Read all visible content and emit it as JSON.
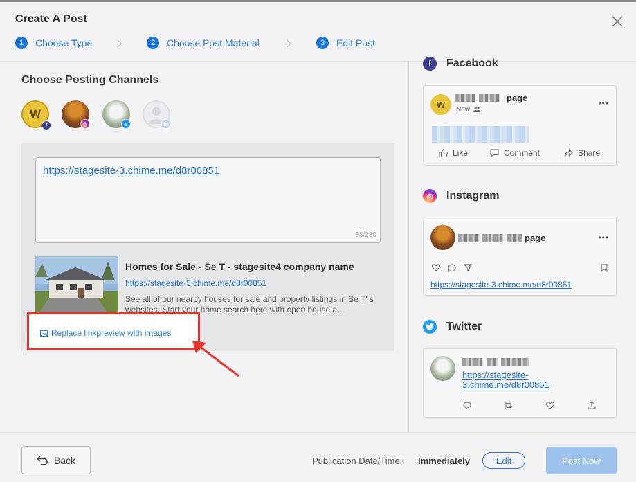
{
  "modal": {
    "title": "Create A Post"
  },
  "steps": [
    {
      "number": "1",
      "label": "Choose Type"
    },
    {
      "number": "2",
      "label": "Choose Post Material"
    },
    {
      "number": "3",
      "label": "Edit Post"
    }
  ],
  "channels": {
    "title": "Choose Posting Channels",
    "accounts": [
      {
        "initial": "W",
        "network": "facebook",
        "selected": true
      },
      {
        "network": "instagram",
        "selected": true
      },
      {
        "network": "twitter",
        "selected": true
      },
      {
        "network": "linkedin",
        "selected": false
      }
    ]
  },
  "editor": {
    "text": "https://stagesite-3.chime.me/d8r00851",
    "counter": "38/280"
  },
  "link_preview": {
    "title": "Homes for Sale - Se T - stagesite4 company name",
    "url": "https://stagesite-3.chime.me/d8r00851",
    "description": "See all of our nearby houses for sale and property listings in Se T' s websites. Start your home search here with open house a..."
  },
  "replace_link": {
    "label": "Replace linkpreview with images"
  },
  "previews": {
    "facebook": {
      "name": "Facebook",
      "avatar_initial": "W",
      "page_suffix": "page",
      "sub_label": "New",
      "actions": [
        "Like",
        "Comment",
        "Share"
      ]
    },
    "instagram": {
      "name": "Instagram",
      "page_suffix": "page",
      "link": "https://stagesite-3.chime.me/d8r00851"
    },
    "twitter": {
      "name": "Twitter",
      "link_line1": "https://stagesite-",
      "link_line2": "3.chime.me/d8r00851"
    }
  },
  "footer": {
    "back_label": "Back",
    "publication_label": "Publication Date/Time:",
    "publication_value": "Immediately",
    "edit_label": "Edit",
    "post_now_label": "Post Now"
  },
  "colors": {
    "accent": "#1a73d9",
    "facebook": "#3b3d8f",
    "twitter": "#1d9bf0",
    "highlight": "#e8332a",
    "post_now_disabled": "#9ec3ec"
  },
  "icons": [
    "close-icon",
    "chevron-right-icon",
    "image-icon",
    "like-icon",
    "comment-icon",
    "share-icon",
    "heart-icon",
    "bubble-icon",
    "send-icon",
    "bookmark-icon",
    "reply-icon",
    "retweet-icon",
    "upload-icon",
    "back-arrow-icon",
    "ellipsis-icon",
    "people-icon"
  ]
}
